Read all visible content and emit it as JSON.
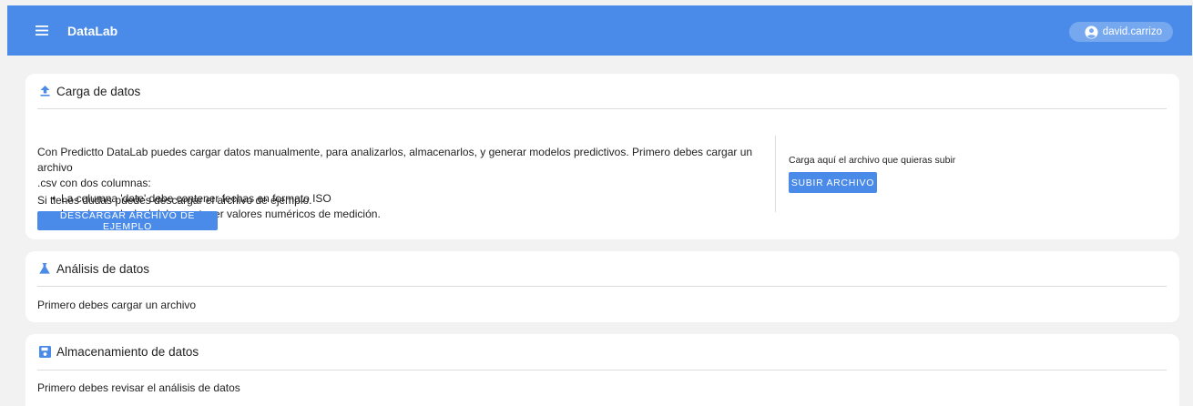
{
  "topbar": {
    "app_title": "DataLab",
    "username": "david.carrizo"
  },
  "upload_card": {
    "title": "Carga de datos",
    "intro_line1": "Con Predictto DataLab puedes cargar datos manualmente, para analizarlos, almacenarlos, y generar modelos predictivos. Primero debes cargar un archivo",
    "intro_line2": ".csv con dos columnas:",
    "bullets": [
      "La columna 'date' debe contener fechas en formato ISO",
      "La columna 'value' debe contener valores numéricos de medición."
    ],
    "doubts_text": "Si tienes dudas puedes descargar el archivo de ejemplo.",
    "download_button": "DESCARGAR ARCHIVO DE EJEMPLO",
    "upload_prompt": "Carga aquí el archivo que quieras subir",
    "upload_button": "SUBIR ARCHIVO"
  },
  "analysis_card": {
    "title": "Análisis de datos",
    "message": "Primero debes cargar un archivo"
  },
  "storage_card": {
    "title": "Almacenamiento de datos",
    "message": "Primero debes revisar el análisis de datos"
  },
  "colors": {
    "primary": "#4a8ae8",
    "background": "#f2f2f2",
    "card": "#ffffff"
  }
}
